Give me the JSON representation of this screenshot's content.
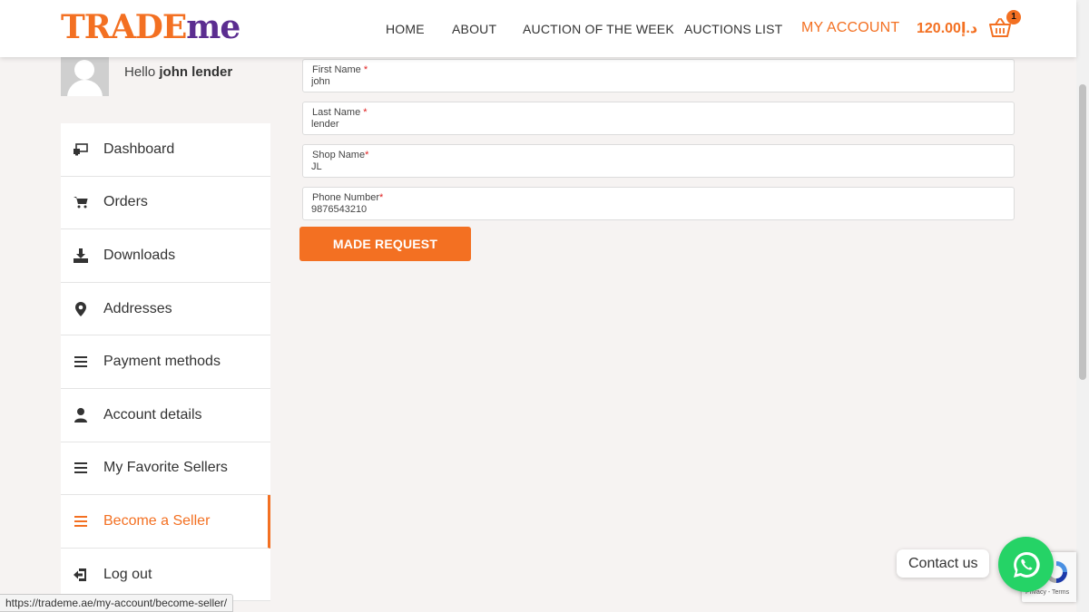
{
  "header": {
    "logo_part1": "TRADE",
    "logo_part2": "me",
    "nav": {
      "home": "HOME",
      "about": "ABOUT",
      "auction_of_week": "AUCTION OF THE WEEK",
      "auctions_list": "AUCTIONS LIST",
      "my_account": "MY ACCOUNT"
    },
    "cart_total": "120.00د.إ",
    "cart_count": "1"
  },
  "user": {
    "greeting": "Hello",
    "name": "john lender"
  },
  "sidebar": {
    "items": [
      {
        "label": "Dashboard",
        "icon": "dashboard-icon"
      },
      {
        "label": "Orders",
        "icon": "cart-icon"
      },
      {
        "label": "Downloads",
        "icon": "download-icon"
      },
      {
        "label": "Addresses",
        "icon": "map-pin-icon"
      },
      {
        "label": "Payment methods",
        "icon": "menu-lines-icon"
      },
      {
        "label": "Account details",
        "icon": "user-icon"
      },
      {
        "label": "My Favorite Sellers",
        "icon": "menu-lines-icon"
      },
      {
        "label": "Become a Seller",
        "icon": "menu-lines-icon",
        "active": true
      },
      {
        "label": "Log out",
        "icon": "logout-icon"
      }
    ]
  },
  "form": {
    "first_name": {
      "label": "First Name",
      "required_mark": "*",
      "value": "john"
    },
    "last_name": {
      "label": "Last Name",
      "required_mark": "*",
      "value": "lender"
    },
    "shop_name": {
      "label": "Shop Name",
      "required_mark": "*",
      "value": "JL"
    },
    "phone": {
      "label": "Phone Number",
      "required_mark": "*",
      "value": "9876543210"
    },
    "submit_label": "MADE REQUEST"
  },
  "widgets": {
    "contact_label": "Contact us",
    "recaptcha_text": "Privacy - Terms",
    "status_url": "https://trademe.ae/my-account/become-seller/"
  },
  "colors": {
    "accent": "#f37022",
    "brand_purple": "#5b2d90",
    "whatsapp": "#25d366"
  }
}
